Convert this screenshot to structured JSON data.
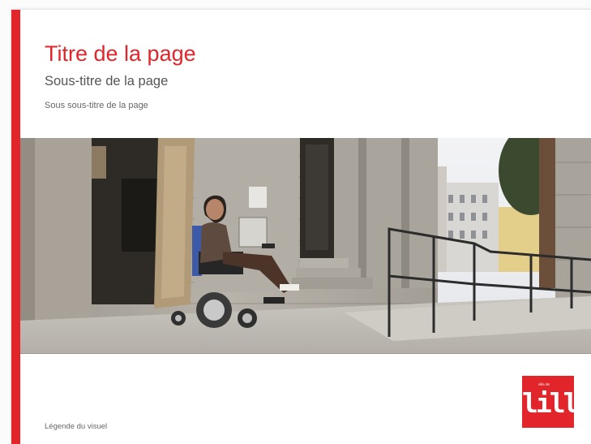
{
  "header": {
    "title": "Titre de la page",
    "subtitle": "Sous-titre de la page",
    "subsubtitle": "Sous sous-titre de la page"
  },
  "visual": {
    "description_icon": "photo-visual",
    "caption": "Légende du visuel"
  },
  "logo": {
    "small_text": "ville de",
    "main_text": "lille"
  },
  "colors": {
    "accent": "#e2252b",
    "title": "#e2252b",
    "subtitle": "#555555",
    "logo_bg": "#e2252b"
  }
}
